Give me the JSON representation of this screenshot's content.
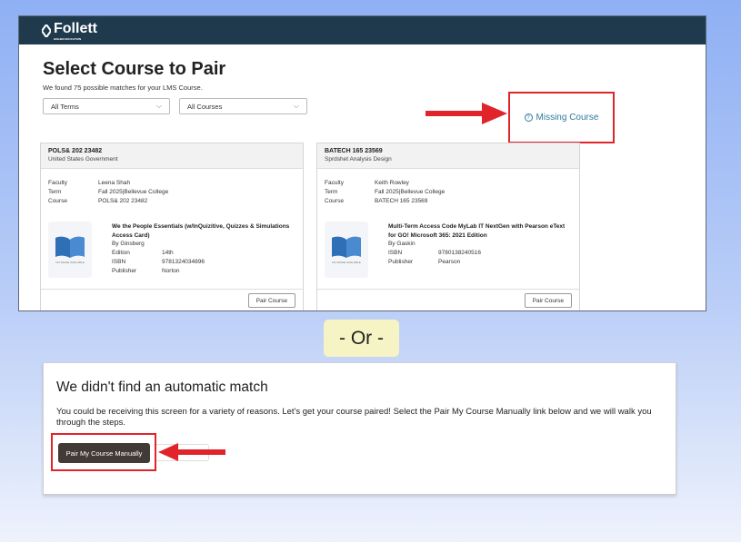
{
  "top_screenshot": {
    "brand": "Follett",
    "brand_sub": "HIGHER EDUCATION",
    "page_title": "Select Course to Pair",
    "matches_text": "We found 75 possible matches for your LMS Course.",
    "term_select": "All Terms",
    "course_select": "All Courses",
    "missing_course": "Missing Course",
    "cards": [
      {
        "code": "POLS& 202 23482",
        "name": "United States Government",
        "faculty_label": "Faculty",
        "faculty": "Leena Shah",
        "term_label": "Term",
        "term": "Fall 2025|Bellevue College",
        "course_label": "Course",
        "course": "POLS& 202 23482",
        "book_title": "We the People Essentials (w/InQuizitive, Quizzes & Simulations Access Card)",
        "book_author": "By Ginsberg",
        "field1_label": "Edition",
        "field1": "14th",
        "isbn_label": "ISBN",
        "isbn": "9781324034896",
        "publisher_label": "Publisher",
        "publisher": "Norton",
        "image_na": "NO IMAGE AVAILABLE",
        "pair_label": "Pair Course"
      },
      {
        "code": "BATECH 165 23569",
        "name": "Sprdshet Analysis Design",
        "faculty_label": "Faculty",
        "faculty": "Keith Rowley",
        "term_label": "Term",
        "term": "Fall 2025|Bellevue College",
        "course_label": "Course",
        "course": "BATECH 165 23569",
        "book_title": "Multi-Term Access Code MyLab IT NextGen with Pearson eText for GO! Microsoft 365: 2021 Edition",
        "book_author": "By Gaskin",
        "isbn_label": "ISBN",
        "isbn": "9780138240516",
        "publisher_label": "Publisher",
        "publisher": "Pearson",
        "image_na": "NO IMAGE AVAILABLE",
        "pair_label": "Pair Course"
      }
    ]
  },
  "or_label": "- Or -",
  "bottom_screenshot": {
    "title": "We didn't find an automatic match",
    "body": "You could be receiving this screen for a variety of reasons. Let's get your course paired!  Select the Pair My Course Manually link below and we will walk you through the steps.",
    "manual_button": "Pair My Course Manually"
  },
  "colors": {
    "highlight_red": "#e0242a",
    "header_navy": "#1f3a4d",
    "or_pill": "#f6f3c4",
    "manual_button_bg": "#413a35",
    "link_teal": "#2f7a9a"
  }
}
